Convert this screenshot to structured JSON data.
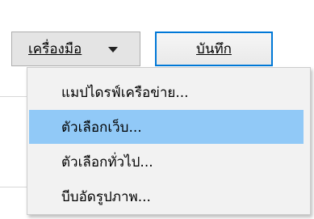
{
  "toolbar": {
    "tools_label": "เครื่องมือ",
    "tools_chevron_icon": "chevron-down-icon",
    "save_label": "บันทึก",
    "save_border_color": "#0078d7"
  },
  "menu": {
    "selected_index": 1,
    "highlight_color": "#91c9f7",
    "items": [
      {
        "label": "แมปไดรฟ์เครือข่าย..."
      },
      {
        "label": "ตัวเลือกเว็บ..."
      },
      {
        "label": "ตัวเลือกทั่วไป..."
      },
      {
        "label": "บีบอัดรูปภาพ..."
      }
    ]
  }
}
